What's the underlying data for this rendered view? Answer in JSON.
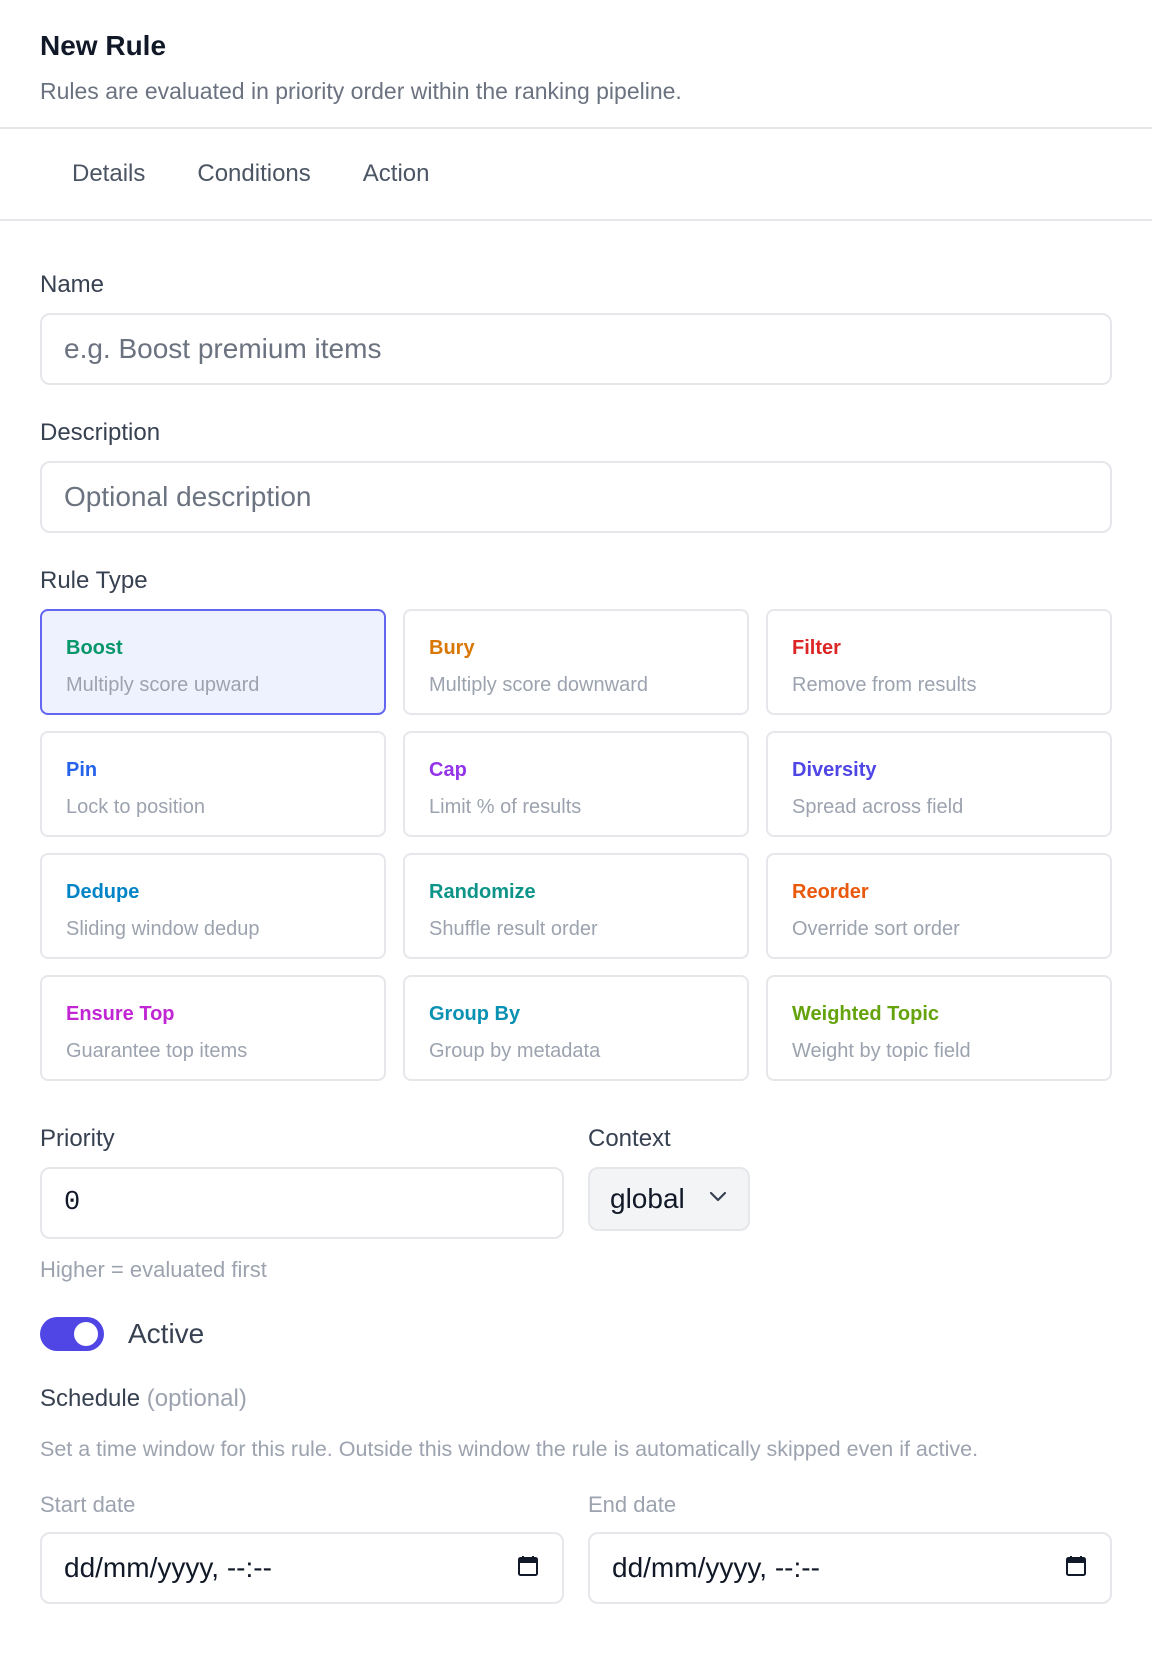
{
  "header": {
    "title": "New Rule",
    "subtitle": "Rules are evaluated in priority order within the ranking pipeline."
  },
  "tabs": [
    {
      "label": "Details"
    },
    {
      "label": "Conditions"
    },
    {
      "label": "Action"
    }
  ],
  "form": {
    "name": {
      "label": "Name",
      "placeholder": "e.g. Boost premium items"
    },
    "description": {
      "label": "Description",
      "placeholder": "Optional description"
    },
    "rule_type": {
      "label": "Rule Type",
      "selected": "Boost",
      "options": [
        {
          "title": "Boost",
          "desc": "Multiply score upward",
          "color": "#059669"
        },
        {
          "title": "Bury",
          "desc": "Multiply score downward",
          "color": "#d97706"
        },
        {
          "title": "Filter",
          "desc": "Remove from results",
          "color": "#dc2626"
        },
        {
          "title": "Pin",
          "desc": "Lock to position",
          "color": "#2563eb"
        },
        {
          "title": "Cap",
          "desc": "Limit % of results",
          "color": "#9333ea"
        },
        {
          "title": "Diversity",
          "desc": "Spread across field",
          "color": "#4f46e5"
        },
        {
          "title": "Dedupe",
          "desc": "Sliding window dedup",
          "color": "#0284c7"
        },
        {
          "title": "Randomize",
          "desc": "Shuffle result order",
          "color": "#0d9488"
        },
        {
          "title": "Reorder",
          "desc": "Override sort order",
          "color": "#ea580c"
        },
        {
          "title": "Ensure Top",
          "desc": "Guarantee top items",
          "color": "#c026d3"
        },
        {
          "title": "Group By",
          "desc": "Group by metadata",
          "color": "#0891b2"
        },
        {
          "title": "Weighted Topic",
          "desc": "Weight by topic field",
          "color": "#65a30d"
        }
      ]
    },
    "priority": {
      "label": "Priority",
      "value": "0",
      "hint": "Higher = evaluated first"
    },
    "context": {
      "label": "Context",
      "value": "global",
      "icon": "chevron-down-icon"
    },
    "active": {
      "label": "Active",
      "on": true,
      "color": "#4f46e5"
    },
    "schedule": {
      "label": "Schedule",
      "optional": "(optional)",
      "description": "Set a time window for this rule. Outside this window the rule is automatically skipped even if active.",
      "start": {
        "label": "Start date",
        "placeholder": "dd/mm/yyyy, --:--",
        "icon": "calendar-icon"
      },
      "end": {
        "label": "End date",
        "placeholder": "dd/mm/yyyy, --:--",
        "icon": "calendar-icon"
      }
    }
  }
}
